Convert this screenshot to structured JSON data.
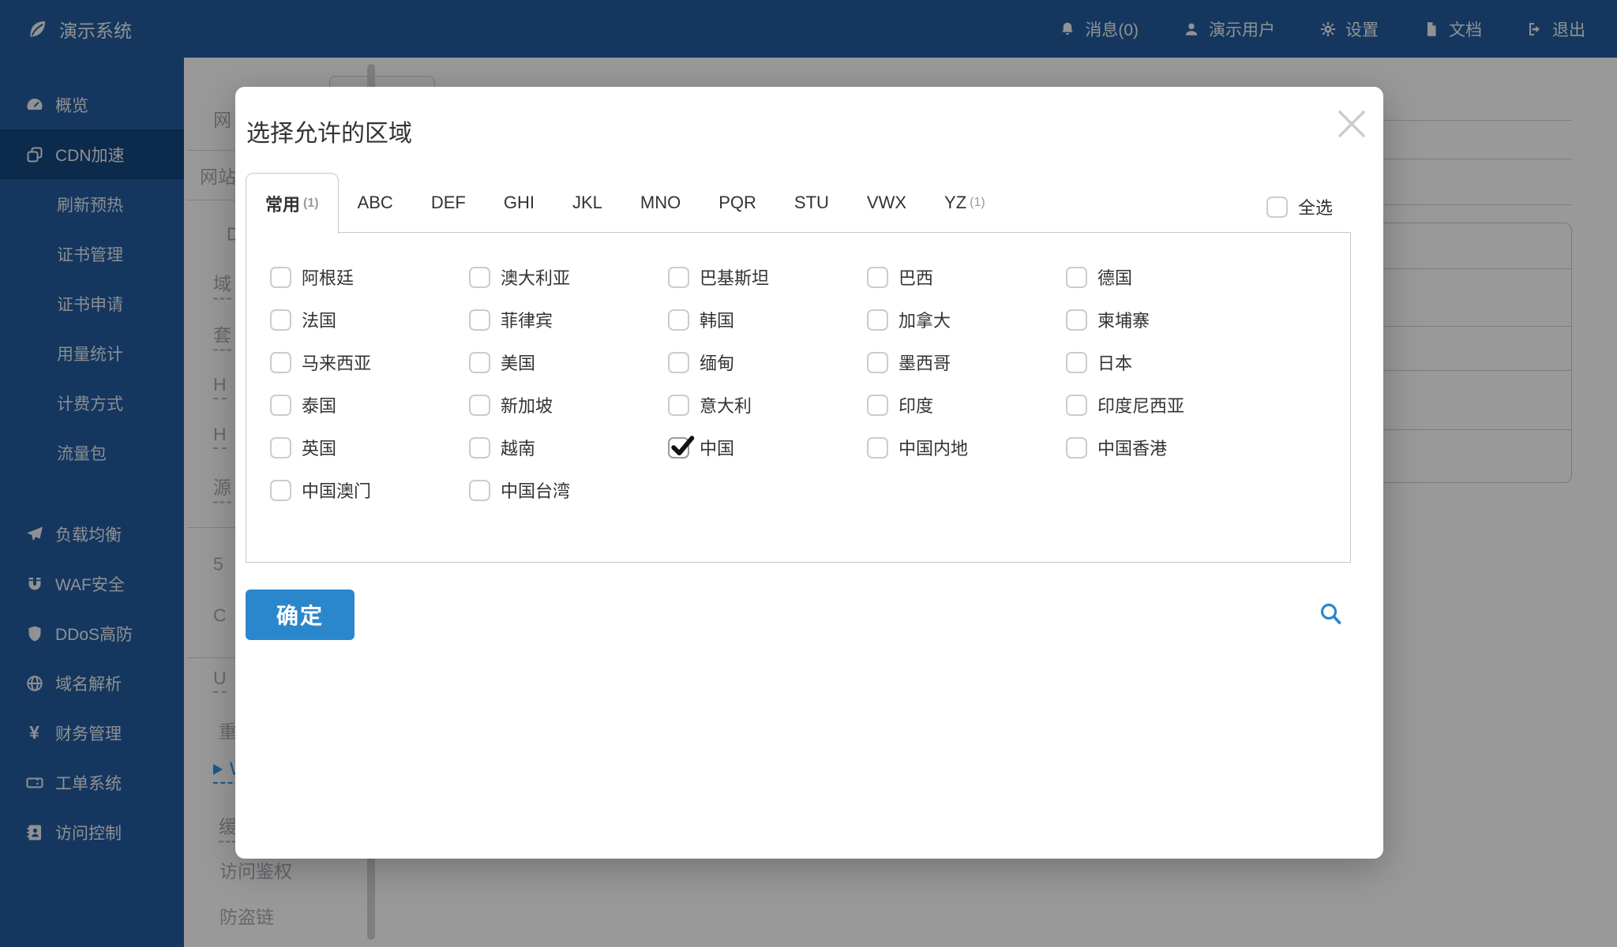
{
  "colors": {
    "navbar_navy": "#235c9e",
    "sidebar_active": "#15467f",
    "sidebar_active_border": "#153f73",
    "accent_blue": "#2b87cc",
    "link_blue": "#2f97e8",
    "overlay": "rgba(0,0,0,0.40)",
    "modal_text": "#333333",
    "muted_text": "#999999",
    "checkbox_border": "#cccccc",
    "check_mark": "#111111"
  },
  "navbar": {
    "brand": "演示系统",
    "brand_icon": "leaf-icon",
    "items": [
      {
        "icon": "bell-icon",
        "label": "消息(0)"
      },
      {
        "icon": "user-icon",
        "label": "演示用户"
      },
      {
        "icon": "gear-icon",
        "label": "设置"
      },
      {
        "icon": "document-icon",
        "label": "文档"
      },
      {
        "icon": "logout-icon",
        "label": "退出"
      }
    ]
  },
  "sidebar": {
    "items": [
      {
        "type": "main",
        "icon": "gauge-icon",
        "label": "概览"
      },
      {
        "type": "main",
        "icon": "clone-icon",
        "label": "CDN加速",
        "active": true
      },
      {
        "type": "sub",
        "label": "刷新预热"
      },
      {
        "type": "sub",
        "label": "证书管理"
      },
      {
        "type": "sub",
        "label": "证书申请"
      },
      {
        "type": "sub",
        "label": "用量统计"
      },
      {
        "type": "sub",
        "label": "计费方式"
      },
      {
        "type": "sub",
        "label": "流量包"
      },
      {
        "type": "main",
        "icon": "paper-plane-icon",
        "label": "负载均衡"
      },
      {
        "type": "main",
        "icon": "magnet-icon",
        "label": "WAF安全"
      },
      {
        "type": "main",
        "icon": "shield-icon",
        "label": "DDoS高防"
      },
      {
        "type": "main",
        "icon": "globe-icon",
        "label": "域名解析"
      },
      {
        "type": "main",
        "icon": "yen-icon",
        "label": "财务管理"
      },
      {
        "type": "main",
        "icon": "ticket-icon",
        "label": "工单系统"
      },
      {
        "type": "main",
        "icon": "address-book-icon",
        "label": "访问控制"
      }
    ]
  },
  "background": {
    "menu_items": [
      {
        "label": "网"
      },
      {
        "label": "网站"
      },
      {
        "label": "D"
      },
      {
        "label": "域",
        "underline": true
      },
      {
        "label": "套",
        "underline": true
      },
      {
        "label": "H",
        "underline": true
      },
      {
        "label": "H",
        "underline": true
      },
      {
        "label": "源",
        "underline": true
      },
      {
        "label": "5"
      },
      {
        "label": "C"
      },
      {
        "label": "U",
        "underline": true
      },
      {
        "label": "重"
      },
      {
        "label": "W",
        "underline": true,
        "active": true
      },
      {
        "label": "缓",
        "underline": true
      },
      {
        "label": "访问鉴权"
      },
      {
        "label": "防盗链"
      }
    ]
  },
  "modal": {
    "title": "选择允许的区域",
    "tabs": [
      {
        "label": "常用",
        "count": "(1)",
        "active": true
      },
      {
        "label": "ABC"
      },
      {
        "label": "DEF"
      },
      {
        "label": "GHI"
      },
      {
        "label": "JKL"
      },
      {
        "label": "MNO"
      },
      {
        "label": "PQR"
      },
      {
        "label": "STU"
      },
      {
        "label": "VWX"
      },
      {
        "label": "YZ",
        "count": "(1)"
      }
    ],
    "select_all": {
      "label": "全选",
      "checked": false
    },
    "regions": [
      {
        "label": "阿根廷",
        "checked": false
      },
      {
        "label": "澳大利亚",
        "checked": false
      },
      {
        "label": "巴基斯坦",
        "checked": false
      },
      {
        "label": "巴西",
        "checked": false
      },
      {
        "label": "德国",
        "checked": false
      },
      {
        "label": "法国",
        "checked": false
      },
      {
        "label": "菲律宾",
        "checked": false
      },
      {
        "label": "韩国",
        "checked": false
      },
      {
        "label": "加拿大",
        "checked": false
      },
      {
        "label": "柬埔寨",
        "checked": false
      },
      {
        "label": "马来西亚",
        "checked": false
      },
      {
        "label": "美国",
        "checked": false
      },
      {
        "label": "缅甸",
        "checked": false
      },
      {
        "label": "墨西哥",
        "checked": false
      },
      {
        "label": "日本",
        "checked": false
      },
      {
        "label": "泰国",
        "checked": false
      },
      {
        "label": "新加坡",
        "checked": false
      },
      {
        "label": "意大利",
        "checked": false
      },
      {
        "label": "印度",
        "checked": false
      },
      {
        "label": "印度尼西亚",
        "checked": false
      },
      {
        "label": "英国",
        "checked": false
      },
      {
        "label": "越南",
        "checked": false
      },
      {
        "label": "中国",
        "checked": true
      },
      {
        "label": "中国内地",
        "checked": false
      },
      {
        "label": "中国香港",
        "checked": false
      },
      {
        "label": "中国澳门",
        "checked": false
      },
      {
        "label": "中国台湾",
        "checked": false
      }
    ],
    "confirm_label": "确定"
  }
}
